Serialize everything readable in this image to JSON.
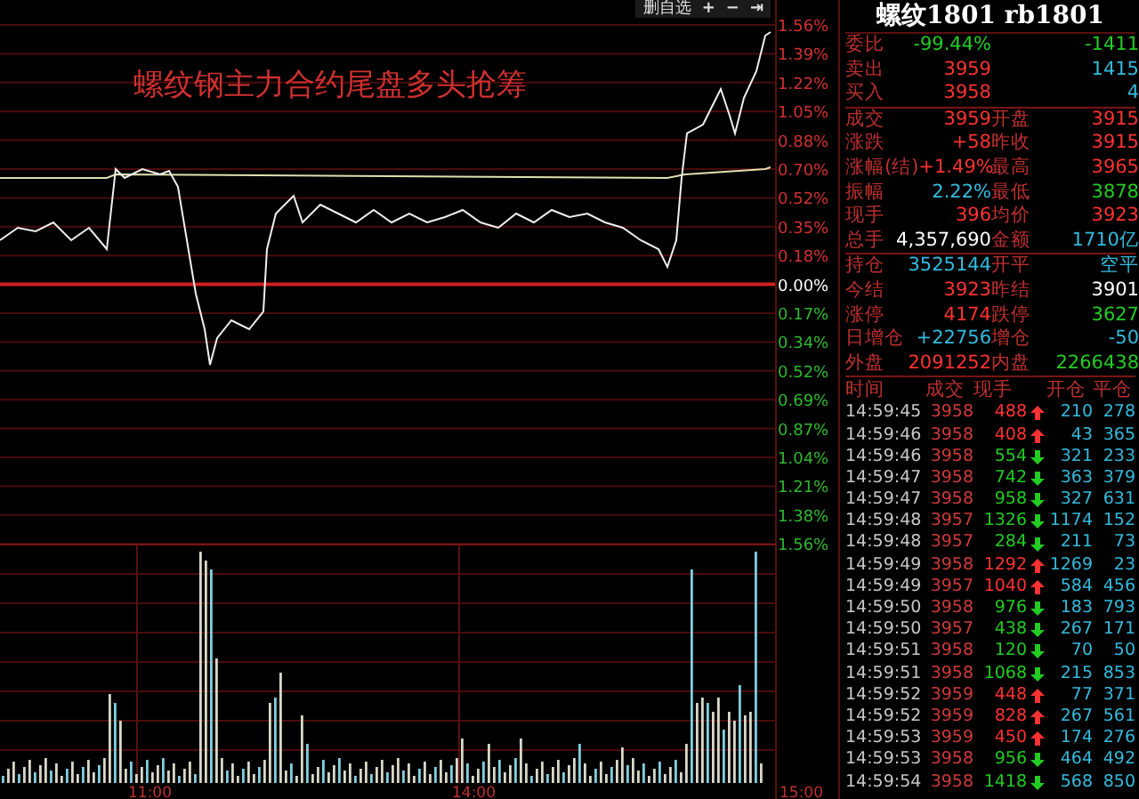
{
  "toolbar": {
    "buttons": [
      {
        "label": "删自选"
      },
      {
        "label": "+"
      },
      {
        "label": "−"
      },
      {
        "label": "⇥"
      }
    ]
  },
  "chart": {
    "headline": "螺纹钢主力合约尾盘多头抢筹",
    "price_axis": [
      {
        "label": "1.56%",
        "kind": "up"
      },
      {
        "label": "1.39%",
        "kind": "up"
      },
      {
        "label": "1.22%",
        "kind": "up"
      },
      {
        "label": "1.05%",
        "kind": "up"
      },
      {
        "label": "0.88%",
        "kind": "up"
      },
      {
        "label": "0.70%",
        "kind": "up"
      },
      {
        "label": "0.52%",
        "kind": "up"
      },
      {
        "label": "0.35%",
        "kind": "up"
      },
      {
        "label": "0.18%",
        "kind": "up"
      },
      {
        "label": "0.00%",
        "kind": "zero"
      },
      {
        "label": "0.17%",
        "kind": "down"
      },
      {
        "label": "0.34%",
        "kind": "down"
      },
      {
        "label": "0.52%",
        "kind": "down"
      },
      {
        "label": "0.69%",
        "kind": "down"
      },
      {
        "label": "0.87%",
        "kind": "down"
      },
      {
        "label": "1.04%",
        "kind": "down"
      },
      {
        "label": "1.21%",
        "kind": "down"
      },
      {
        "label": "1.38%",
        "kind": "down"
      },
      {
        "label": "1.56%",
        "kind": "down"
      }
    ],
    "time_axis": [
      "11:00",
      "14:00",
      "15:00"
    ]
  },
  "quote": {
    "title": "螺纹1801 rb1801",
    "rows": [
      {
        "left": {
          "label": "委比",
          "value": "-99.44%",
          "color": "#22cc22"
        },
        "right": {
          "value": "-1411",
          "color": "#22cc22"
        },
        "divider": false
      },
      {
        "left": {
          "label": "卖出",
          "value": "3959",
          "color": "#ff3232"
        },
        "right": {
          "value": "1415",
          "color": "#33bbdd"
        },
        "divider": false
      },
      {
        "left": {
          "label": "买入",
          "value": "3958",
          "color": "#ff3232"
        },
        "right": {
          "value": "4",
          "color": "#33bbdd"
        },
        "divider": true
      },
      {
        "left": {
          "label": "成交",
          "value": "3959",
          "color": "#ff3232"
        },
        "right": {
          "label": "开盘",
          "value": "3915",
          "color": "#ff3232"
        },
        "divider": false
      },
      {
        "left": {
          "label": "涨跌",
          "value": "+58",
          "color": "#ff3232"
        },
        "right": {
          "label": "昨收",
          "value": "3915",
          "color": "#ff3232"
        },
        "divider": false
      },
      {
        "left": {
          "label": "涨幅(结)",
          "value": "+1.49%",
          "color": "#ff3232"
        },
        "right": {
          "label": "最高",
          "value": "3965",
          "color": "#ff3232"
        },
        "divider": false
      },
      {
        "left": {
          "label": "振幅",
          "value": "2.22%",
          "color": "#33bbdd"
        },
        "right": {
          "label": "最低",
          "value": "3878",
          "color": "#22cc22"
        },
        "divider": false
      },
      {
        "left": {
          "label": "现手",
          "value": "396",
          "color": "#ff3232"
        },
        "right": {
          "label": "均价",
          "value": "3923",
          "color": "#ff3232"
        },
        "divider": false
      },
      {
        "left": {
          "label": "总手",
          "value": "4,357,690",
          "color": "#ffffff"
        },
        "right": {
          "label": "金额",
          "value": "1710亿",
          "color": "#33bbdd"
        },
        "divider": true
      },
      {
        "left": {
          "label": "持仓",
          "value": "3525144",
          "color": "#33bbdd"
        },
        "right": {
          "label": "开平",
          "value": "空平",
          "color": "#33bbdd"
        },
        "divider": false
      },
      {
        "left": {
          "label": "今结",
          "value": "3923",
          "color": "#ff3232"
        },
        "right": {
          "label": "昨结",
          "value": "3901",
          "color": "#ffffff"
        },
        "divider": false
      },
      {
        "left": {
          "label": "涨停",
          "value": "4174",
          "color": "#ff3232"
        },
        "right": {
          "label": "跌停",
          "value": "3627",
          "color": "#22cc22"
        },
        "divider": false
      },
      {
        "left": {
          "label": "日增仓",
          "value": "+22756",
          "color": "#33bbdd"
        },
        "right": {
          "label": "增仓",
          "value": "-50",
          "color": "#33bbdd"
        },
        "divider": false
      },
      {
        "left": {
          "label": "外盘",
          "value": "2091252",
          "color": "#ff3232"
        },
        "right": {
          "label": "内盘",
          "value": "2266438",
          "color": "#22cc22"
        },
        "divider": true
      }
    ]
  },
  "trades": {
    "columns": [
      "时间",
      "成交",
      "现手",
      "开仓",
      "平仓"
    ],
    "rows": [
      {
        "time": "14:59:45",
        "price": "3958",
        "volume": "488",
        "kind": "up",
        "open": "210",
        "close": "278"
      },
      {
        "time": "14:59:46",
        "price": "3958",
        "volume": "408",
        "kind": "up",
        "open": "43",
        "close": "365"
      },
      {
        "time": "14:59:46",
        "price": "3958",
        "volume": "554",
        "kind": "down",
        "open": "321",
        "close": "233"
      },
      {
        "time": "14:59:47",
        "price": "3958",
        "volume": "742",
        "kind": "down",
        "open": "363",
        "close": "379"
      },
      {
        "time": "14:59:47",
        "price": "3958",
        "volume": "958",
        "kind": "down",
        "open": "327",
        "close": "631"
      },
      {
        "time": "14:59:48",
        "price": "3957",
        "volume": "1326",
        "kind": "down",
        "open": "1174",
        "close": "152"
      },
      {
        "time": "14:59:48",
        "price": "3957",
        "volume": "284",
        "kind": "down",
        "open": "211",
        "close": "73"
      },
      {
        "time": "14:59:49",
        "price": "3958",
        "volume": "1292",
        "kind": "up",
        "open": "1269",
        "close": "23"
      },
      {
        "time": "14:59:49",
        "price": "3957",
        "volume": "1040",
        "kind": "up",
        "open": "584",
        "close": "456"
      },
      {
        "time": "14:59:50",
        "price": "3958",
        "volume": "976",
        "kind": "down",
        "open": "183",
        "close": "793"
      },
      {
        "time": "14:59:50",
        "price": "3957",
        "volume": "438",
        "kind": "down",
        "open": "267",
        "close": "171"
      },
      {
        "time": "14:59:51",
        "price": "3958",
        "volume": "120",
        "kind": "down",
        "open": "70",
        "close": "50"
      },
      {
        "time": "14:59:51",
        "price": "3958",
        "volume": "1068",
        "kind": "down",
        "open": "215",
        "close": "853"
      },
      {
        "time": "14:59:52",
        "price": "3959",
        "volume": "448",
        "kind": "up",
        "open": "77",
        "close": "371"
      },
      {
        "time": "14:59:52",
        "price": "3959",
        "volume": "828",
        "kind": "up",
        "open": "267",
        "close": "561"
      },
      {
        "time": "14:59:53",
        "price": "3959",
        "volume": "450",
        "kind": "up",
        "open": "174",
        "close": "276"
      },
      {
        "time": "14:59:53",
        "price": "3958",
        "volume": "956",
        "kind": "down",
        "open": "464",
        "close": "492"
      },
      {
        "time": "14:59:54",
        "price": "3958",
        "volume": "1418",
        "kind": "down",
        "open": "568",
        "close": "850"
      }
    ]
  }
}
